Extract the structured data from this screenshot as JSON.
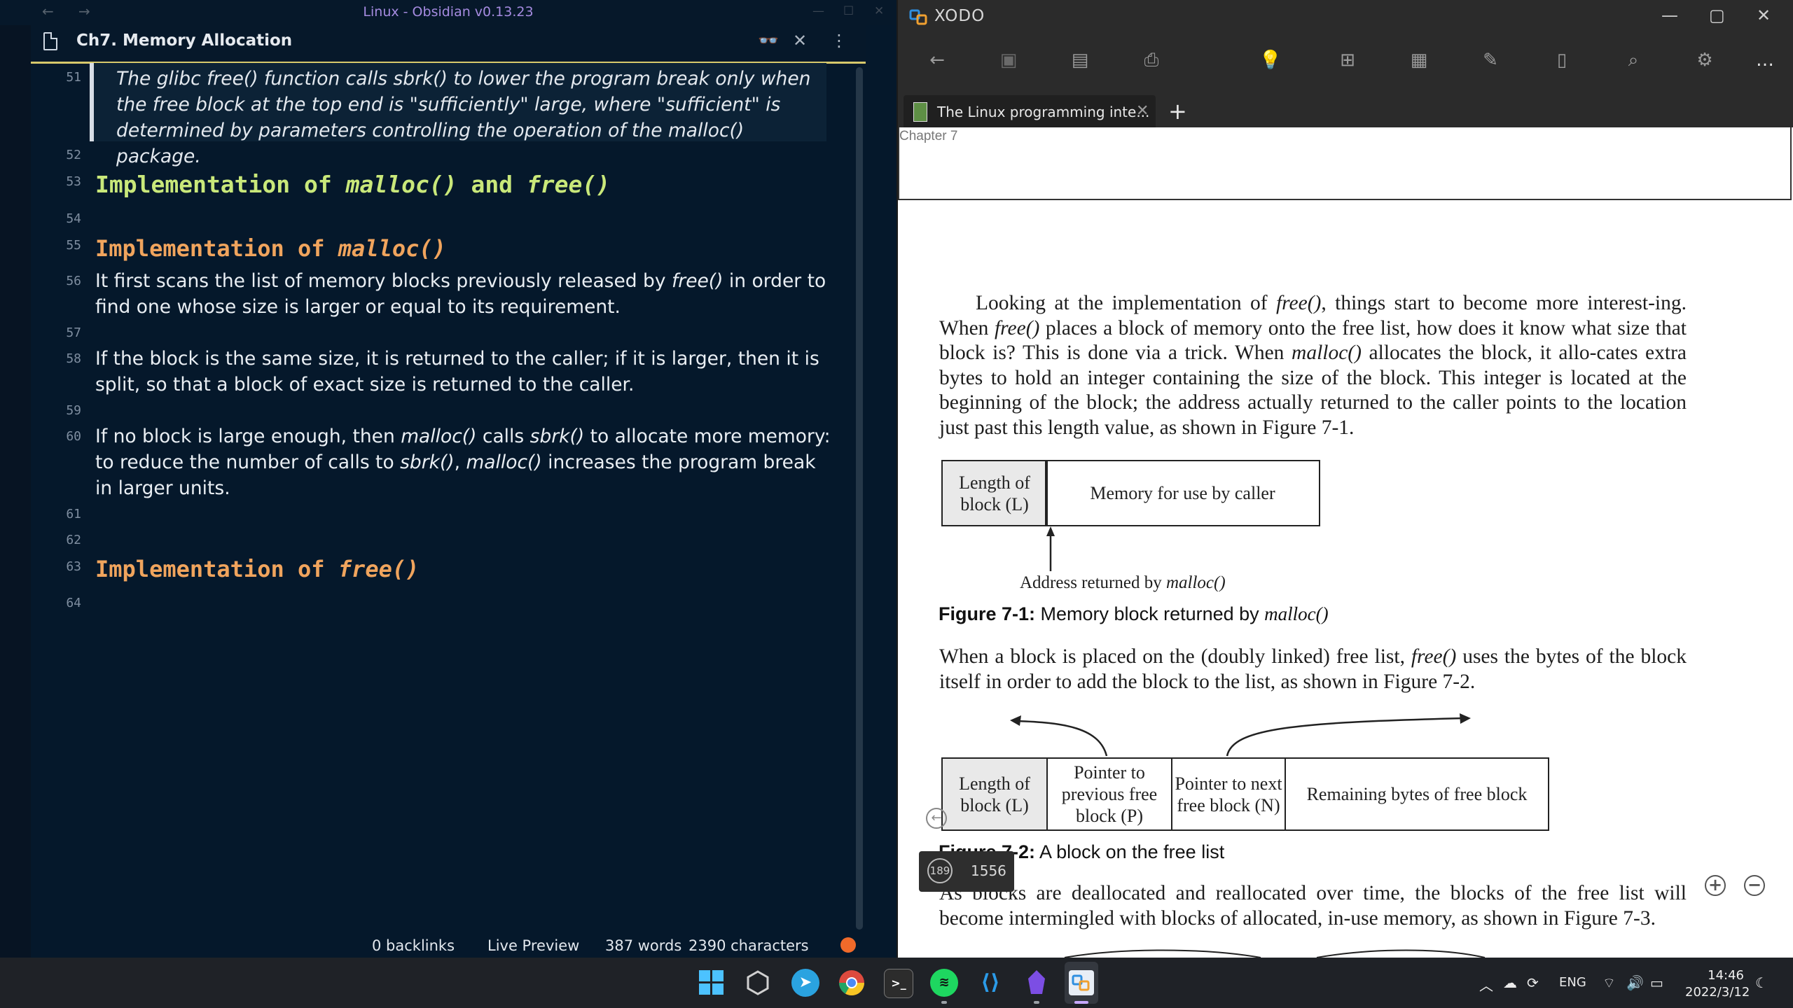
{
  "obsidian": {
    "window_title": "Linux - Obsidian v0.13.23",
    "file_title": "Ch7. Memory Allocation",
    "lines": [
      {
        "num": "51",
        "quote": "The glibc free() function calls sbrk() to lower the program break only when the free block at the top end is \"sufficiently\" large, where \"sufficient\" is determined by parameters controlling the operation of the malloc() package."
      },
      {
        "num": "52"
      },
      {
        "num": "53",
        "h2_a": "Implementation of ",
        "h2_b": "malloc()",
        "h2_c": " and ",
        "h2_d": "free()"
      },
      {
        "num": "54"
      },
      {
        "num": "55",
        "h3_a": "Implementation of ",
        "h3_b": "malloc()"
      },
      {
        "num": "56",
        "t1": "It first scans the list of memory blocks previously released by ",
        "t2": "free()",
        "t3": " in order to find one whose size is larger or equal to its requirement."
      },
      {
        "num": "57"
      },
      {
        "num": "58",
        "text": "If the block is the same size, it is returned to the caller; if it is larger, then it is split, so that a block of exact size is returned to the caller."
      },
      {
        "num": "59"
      },
      {
        "num": "60",
        "t1": "If no block is large enough, then ",
        "t2": "malloc()",
        "t3": " calls ",
        "t4": "sbrk()",
        "t5": " to allocate more memory: to reduce the number of calls to ",
        "t6": "sbrk()",
        "t7": ", ",
        "t8": "malloc()",
        "t9": " increases the program break in larger units."
      },
      {
        "num": "61"
      },
      {
        "num": "62"
      },
      {
        "num": "63",
        "h3_a": "Implementation of ",
        "h3_b": "free()"
      },
      {
        "num": "64"
      }
    ],
    "status": {
      "backlinks": "0 backlinks",
      "mode": "Live Preview",
      "words": "387 words",
      "chars": "2390 characters"
    },
    "accent_colors": {
      "h2": "#c9e87a",
      "h3": "#f0a45d",
      "tab_underline": "#d7c86b"
    }
  },
  "xodo": {
    "app_name": "XODO",
    "tab_title": "The Linux programming inte...",
    "chapter_label": "Chapter 7",
    "para1": {
      "a": "Looking at the implementation of ",
      "b": "free()",
      "c": ", things start to become more interest-ing. When ",
      "d": "free()",
      "e": " places a block of memory onto the free list, how does it know what size that block is? This is done via a trick. When ",
      "f": "malloc()",
      "g": " allocates the block, it allo-cates extra bytes to hold an integer containing the size of the block. This integer is located at the beginning of the block; the address actually returned to the caller points to the location just past this length value, as shown in Figure 7-1."
    },
    "fig1": {
      "box1": "Length of block (L)",
      "box2": "Memory for use by caller",
      "arrow_label_a": "Address returned by ",
      "arrow_label_b": "malloc()",
      "caption_num": "Figure 7-1:",
      "caption_a": " Memory block returned by ",
      "caption_b": "malloc()"
    },
    "para2": {
      "a": "When a block is placed on the (doubly linked) free list, ",
      "b": "free()",
      "c": " uses the bytes of the block itself in order to add the block to the list, as shown in Figure 7-2."
    },
    "fig2": {
      "box1": "Length of block (L)",
      "box2": "Pointer to previous free block (P)",
      "box3": "Pointer to next free block (N)",
      "box4": "Remaining bytes of free block",
      "caption_num": "Figure 7-2:",
      "caption_text": " A block on the free list"
    },
    "para3": "As blocks are deallocated and reallocated over time, the blocks of the free list will become intermingled with blocks of allocated, in-use memory, as shown in Figure 7-3.",
    "page_badge": {
      "current": "189",
      "total": "1556"
    }
  },
  "taskbar": {
    "apps": [
      "windows-start",
      "obsidian-gem",
      "telegram",
      "chrome",
      "terminal",
      "spotify",
      "vscode",
      "obsidian",
      "xodo"
    ],
    "lang": "ENG",
    "time": "14:46",
    "date": "2022/3/12"
  }
}
